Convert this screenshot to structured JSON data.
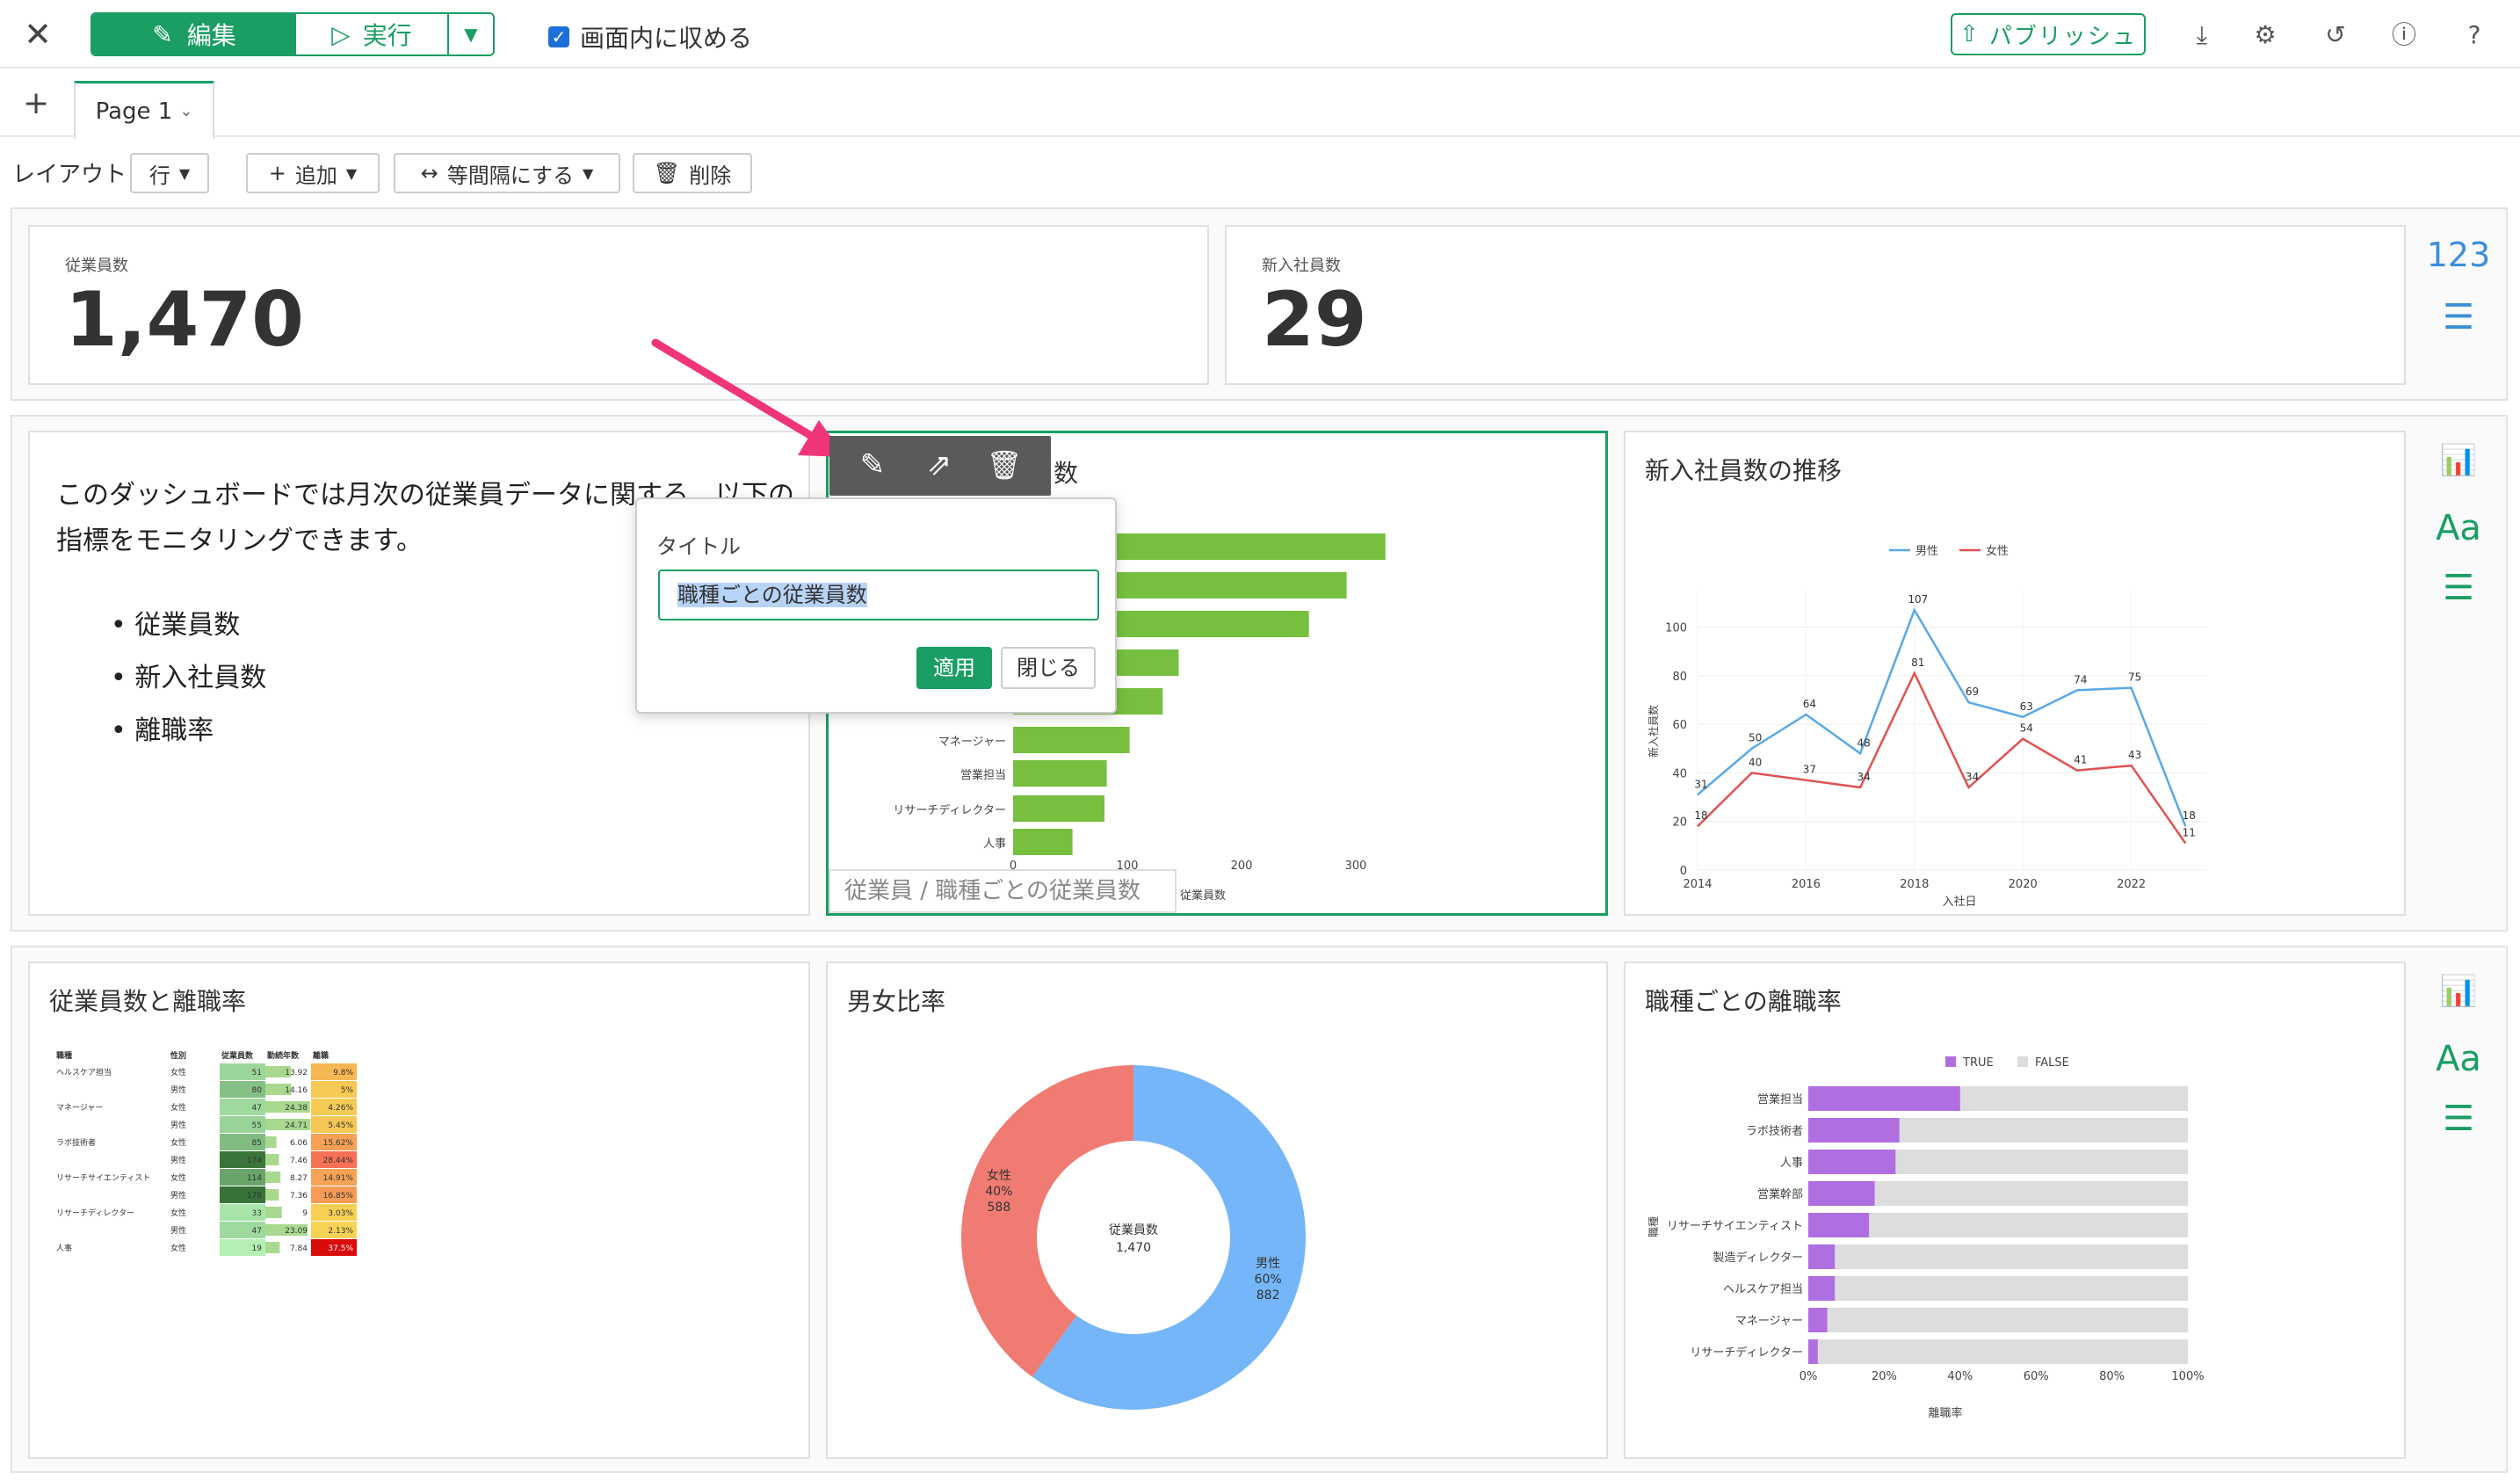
{
  "topbar": {
    "edit_label": "編集",
    "run_label": "実行",
    "fit_label": "画面内に収める",
    "publish_label": "パブリッシュ"
  },
  "tabs": {
    "page_label": "Page 1"
  },
  "layout_bar": {
    "label": "レイアウト",
    "row_label": "行",
    "add_label": "追加",
    "even_label": "等間隔にする",
    "delete_label": "削除"
  },
  "kpis": [
    {
      "label": "従業員数",
      "value": "1,470"
    },
    {
      "label": "新入社員数",
      "value": "29"
    }
  ],
  "side_icons": {
    "kpi_row_text": "123",
    "font_icon_text": "Aa"
  },
  "description": {
    "text": "このダッシュボードでは月次の従業員データに関する、以下の指標をモニタリングできます。",
    "bullets": [
      "従業員数",
      "新入社員数",
      "離職率"
    ]
  },
  "title_popup": {
    "label": "タイトル",
    "value": "職種ごとの従業員数",
    "apply": "適用",
    "close": "閉じる"
  },
  "selected_card": {
    "title_tail": "数",
    "footer": "従業員 / 職種ごとの従業員数"
  },
  "charts": {
    "jobs_bar": {
      "categories": [
        "マネージャー",
        "営業担当",
        "リサーチディレクター",
        "人事"
      ],
      "values": [
        102,
        82,
        80,
        52
      ],
      "hidden_values": [
        326,
        292,
        259,
        145,
        131
      ],
      "xticks": [
        "0",
        "100",
        "200",
        "300"
      ],
      "xlabel": "従業員数"
    },
    "hires_line": {
      "title": "新入社員数の推移",
      "legend": [
        "男性",
        "女性"
      ],
      "colors": {
        "男性": "#5aa9e6",
        "女性": "#e05252"
      },
      "x": [
        2014,
        2015,
        2016,
        2017,
        2018,
        2019,
        2020,
        2021,
        2022,
        2023
      ],
      "male": [
        31,
        50,
        64,
        48,
        107,
        69,
        63,
        74,
        75,
        18
      ],
      "female": [
        18,
        40,
        37,
        34,
        81,
        34,
        54,
        41,
        43,
        11
      ],
      "xticks": [
        "2014",
        "2016",
        "2018",
        "2020",
        "2022"
      ],
      "yticks": [
        "0",
        "20",
        "40",
        "60",
        "80",
        "100"
      ],
      "ylabel": "新入社員数",
      "xlabel": "入社日"
    },
    "turnover_table": {
      "title": "従業員数と離職率",
      "headers": [
        "職種",
        "性別",
        "従業員数",
        "勤続年数",
        "離職"
      ],
      "rows": [
        [
          "ヘルスケア担当",
          "女性",
          "51",
          "13.92",
          "9.8%"
        ],
        [
          "",
          "男性",
          "80",
          "14.16",
          "5%"
        ],
        [
          "マネージャー",
          "女性",
          "47",
          "24.38",
          "4.26%"
        ],
        [
          "",
          "男性",
          "55",
          "24.71",
          "5.45%"
        ],
        [
          "ラボ技術者",
          "女性",
          "85",
          "6.06",
          "15.62%"
        ],
        [
          "",
          "男性",
          "174",
          "7.46",
          "28.44%"
        ],
        [
          "リサーチサイエンティスト",
          "女性",
          "114",
          "8.27",
          "14.91%"
        ],
        [
          "",
          "男性",
          "178",
          "7.36",
          "16.85%"
        ],
        [
          "リサーチディレクター",
          "女性",
          "33",
          "9",
          "3.03%"
        ],
        [
          "",
          "男性",
          "47",
          "23.09",
          "2.13%"
        ],
        [
          "人事",
          "女性",
          "19",
          "7.84",
          "37.5%"
        ]
      ]
    },
    "gender_donut": {
      "title": "男女比率",
      "center_label": "従業員数",
      "center_value": "1,470",
      "slices": [
        {
          "name": "男性",
          "percent": "60%",
          "count": "882",
          "value": 882,
          "color": "#74b6f7"
        },
        {
          "name": "女性",
          "percent": "40%",
          "count": "588",
          "value": 588,
          "color": "#f07b72"
        }
      ]
    },
    "turnover_stacked": {
      "title": "職種ごとの離職率",
      "legend": [
        "TRUE",
        "FALSE"
      ],
      "colors": {
        "TRUE": "#b06fe0",
        "FALSE": "#dddddd"
      },
      "categories": [
        "営業担当",
        "ラボ技術者",
        "人事",
        "営業幹部",
        "リサーチサイエンティスト",
        "製造ディレクター",
        "ヘルスケア担当",
        "マネージャー",
        "リサーチディレクター"
      ],
      "true_ratio": [
        0.4,
        0.24,
        0.23,
        0.175,
        0.16,
        0.07,
        0.07,
        0.05,
        0.025
      ],
      "xticks": [
        "0%",
        "20%",
        "40%",
        "60%",
        "80%",
        "100%"
      ],
      "xlabel": "離職率",
      "ylabel": "職種"
    }
  }
}
